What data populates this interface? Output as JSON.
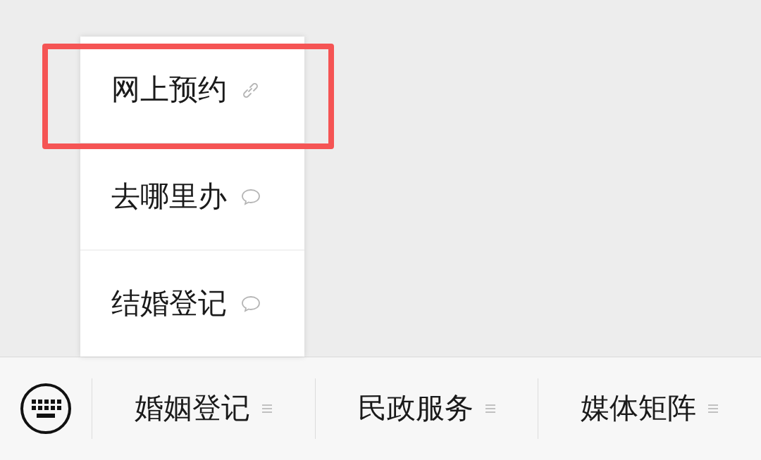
{
  "submenu": {
    "items": [
      {
        "label": "网上预约",
        "kind": "link",
        "highlighted": true
      },
      {
        "label": "去哪里办",
        "kind": "message",
        "highlighted": false
      },
      {
        "label": "结婚登记",
        "kind": "message",
        "highlighted": false
      }
    ]
  },
  "menu_bar": {
    "items": [
      {
        "label": "婚姻登记"
      },
      {
        "label": "民政服务"
      },
      {
        "label": "媒体矩阵"
      }
    ]
  }
}
